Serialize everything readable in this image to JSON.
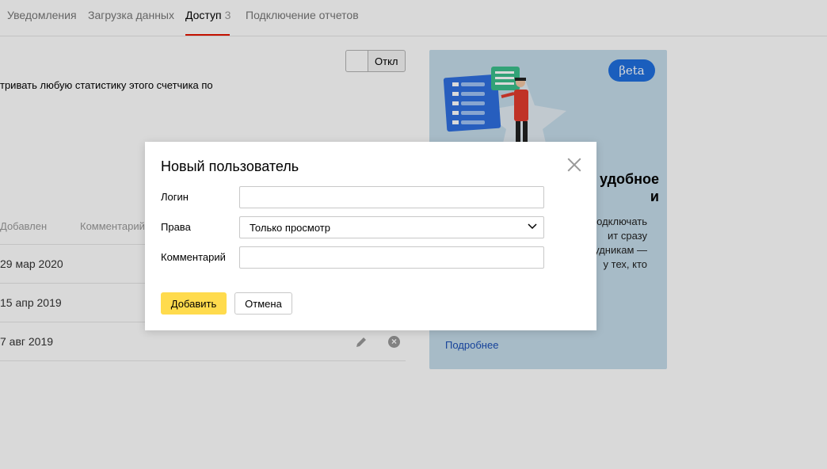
{
  "tabs": [
    {
      "label": "Уведомления"
    },
    {
      "label": "Загрузка данных"
    },
    {
      "label": "Доступ",
      "count": "3",
      "active": true
    },
    {
      "label": "Подключение отчетов"
    }
  ],
  "toggle": {
    "label": "Откл",
    "state": "off"
  },
  "description": "тривать любую статистику этого счетчика по",
  "table": {
    "headers": [
      "Добавлен",
      "Комментарий"
    ],
    "rows": [
      {
        "date": "29 мар 2020"
      },
      {
        "date": "15 апр 2019"
      },
      {
        "date": "7 авг 2019"
      }
    ]
  },
  "promo": {
    "badge": "βeta",
    "title": "удобное\nи",
    "text": "одключать\nит сразу\nудникам —\nу тех, кто",
    "link": "Подробнее"
  },
  "modal": {
    "title": "Новый пользователь",
    "login_label": "Логин",
    "login_value": "",
    "rights_label": "Права",
    "rights_value": "Только просмотр",
    "comment_label": "Комментарий",
    "comment_value": "",
    "add_button": "Добавить",
    "cancel_button": "Отмена"
  },
  "colors": {
    "accent_yellow": "#ffdb4d",
    "tab_active_underline": "#e61400",
    "beta_blue": "#1f6fde",
    "promo_bg": "#c5dcea"
  }
}
